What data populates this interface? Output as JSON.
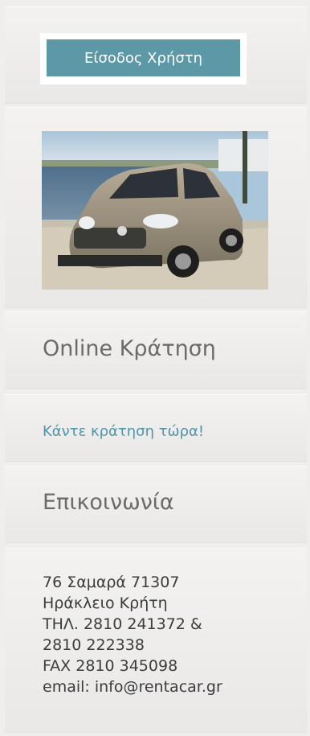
{
  "login": {
    "button_label": "Είσοδος Χρήστη"
  },
  "booking": {
    "title": "Online Κράτηση",
    "link_label": "Κάντε κράτηση τώρα!"
  },
  "contact": {
    "title": "Επικοινωνία",
    "lines": [
      "76 Σαμαρά 71307",
      "Ηράκλειο Κρήτη",
      "ΤΗΛ. 2810 241372 &",
      "2810 222338",
      "FAX 2810 345098",
      "email: info@rentacar.gr"
    ]
  },
  "colors": {
    "accent": "#5c98a5",
    "link": "#4f95a8",
    "heading": "#6b6b6b"
  }
}
